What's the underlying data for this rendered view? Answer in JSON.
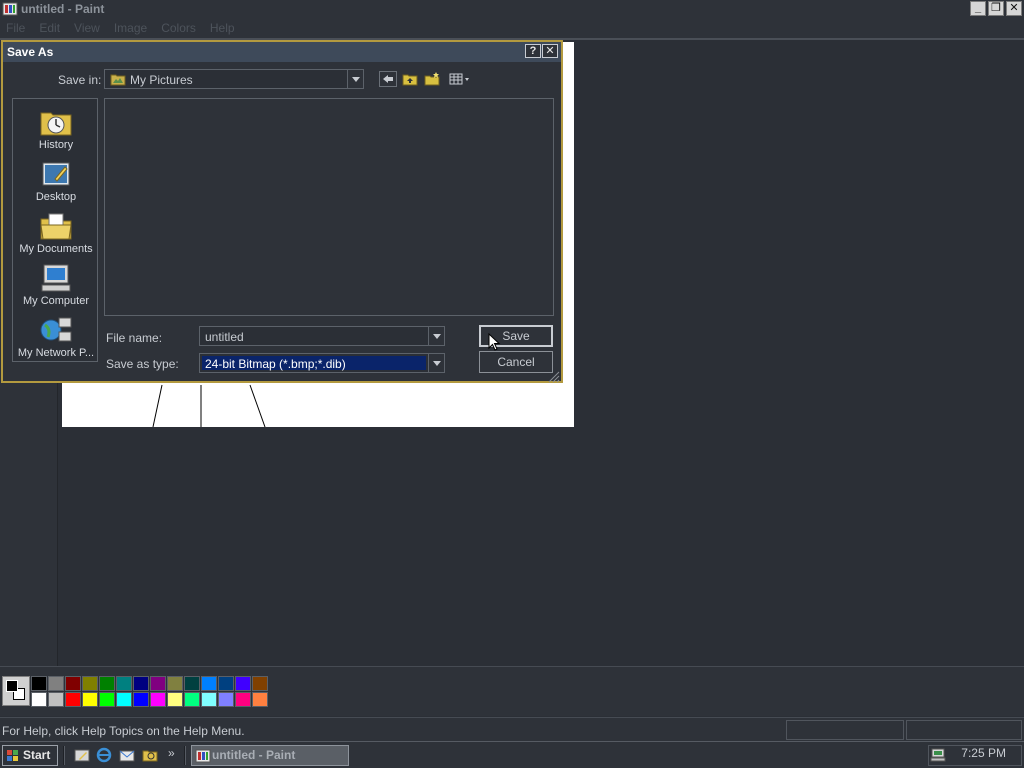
{
  "app": {
    "title": "untitled - Paint",
    "menu": [
      "File",
      "Edit",
      "View",
      "Image",
      "Colors",
      "Help"
    ],
    "window_buttons": [
      "_",
      "❐",
      "✕"
    ]
  },
  "dialog": {
    "title": "Save As",
    "help_button": "?",
    "close_button": "✕",
    "save_in_label": "Save in:",
    "save_in_value": "My Pictures",
    "places": [
      {
        "label": "History",
        "icon": "history-icon"
      },
      {
        "label": "Desktop",
        "icon": "desktop-icon"
      },
      {
        "label": "My Documents",
        "icon": "my-documents-icon"
      },
      {
        "label": "My Computer",
        "icon": "my-computer-icon"
      },
      {
        "label": "My Network P...",
        "icon": "my-network-places-icon"
      }
    ],
    "file_name_label": "File name:",
    "file_name_value": "untitled",
    "save_type_label": "Save as type:",
    "save_type_value": "24-bit Bitmap (*.bmp;*.dib)",
    "save_button": "Save",
    "cancel_button": "Cancel"
  },
  "palette": {
    "colors": [
      "#000000",
      "#808080",
      "#800000",
      "#808000",
      "#008000",
      "#008080",
      "#000080",
      "#800080",
      "#808040",
      "#004040",
      "#0080ff",
      "#004080",
      "#4000ff",
      "#804000",
      "#ffffff",
      "#c0c0c0",
      "#ff0000",
      "#ffff00",
      "#00ff00",
      "#00ffff",
      "#0000ff",
      "#ff00ff",
      "#ffff80",
      "#00ff80",
      "#80ffff",
      "#8080ff",
      "#ff0080",
      "#ff8040"
    ]
  },
  "status": {
    "help_text": "For Help, click Help Topics on the Help Menu."
  },
  "taskbar": {
    "start_label": "Start",
    "chevron": "»",
    "task_label": "untitled - Paint",
    "clock": "7:25 PM"
  }
}
